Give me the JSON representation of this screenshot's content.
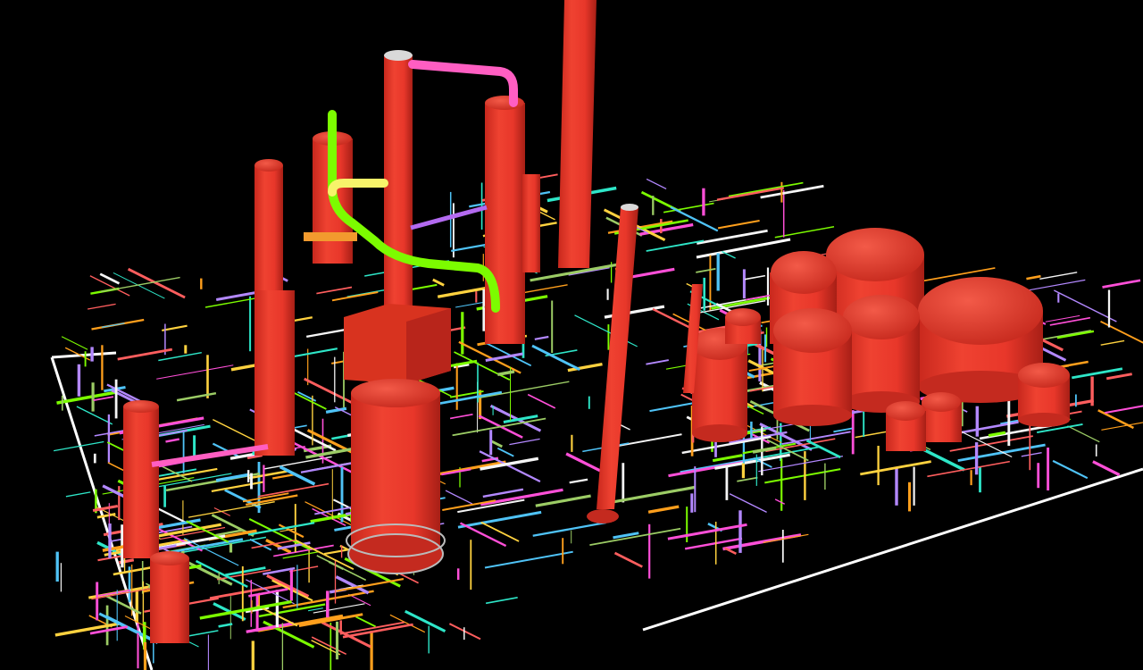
{
  "scene": {
    "background": "#000000",
    "boundary_color": "#ffffff",
    "vessel_color": "#e8372a",
    "vessel_shade": "#b8251b",
    "vessel_highlight": "#f2604f",
    "pipe_colors": [
      "#7CFC00",
      "#FF4FD8",
      "#FFD23F",
      "#4FC3F7",
      "#FF9F1C",
      "#B388FF",
      "#2EE6C8",
      "#F5F5F5",
      "#FF5E5E",
      "#9CCC65"
    ],
    "icons": [
      "plant-model",
      "vessel",
      "tank",
      "pipe-network",
      "site-boundary"
    ]
  }
}
